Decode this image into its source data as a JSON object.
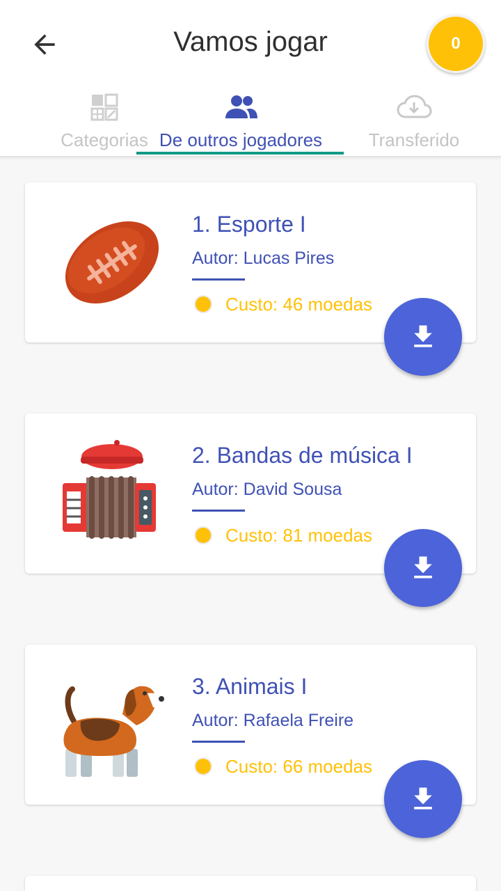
{
  "header": {
    "title": "Vamos jogar",
    "coins": "0"
  },
  "tabs": [
    {
      "label": "Categorias",
      "icon": "grid-icon",
      "active": false
    },
    {
      "label": "De outros jogadores",
      "icon": "people-icon",
      "active": true
    },
    {
      "label": "Transferido",
      "icon": "cloud-download-icon",
      "active": false
    }
  ],
  "cards": [
    {
      "title": "1. Esporte I",
      "author": "Autor: Lucas Pires",
      "cost": "Custo: 46 moedas",
      "image": "football-image"
    },
    {
      "title": "2. Bandas de música I",
      "author": "Autor: David Sousa",
      "cost": "Custo: 81 moedas",
      "image": "accordion-beret-image"
    },
    {
      "title": "3. Animais I",
      "author": "Autor: Rafaela Freire",
      "cost": "Custo: 66 moedas",
      "image": "dog-image"
    }
  ],
  "colors": {
    "primary": "#3f51b5",
    "accent_underline": "#119a87",
    "coin": "#ffc107",
    "fab": "#4c63d9"
  }
}
